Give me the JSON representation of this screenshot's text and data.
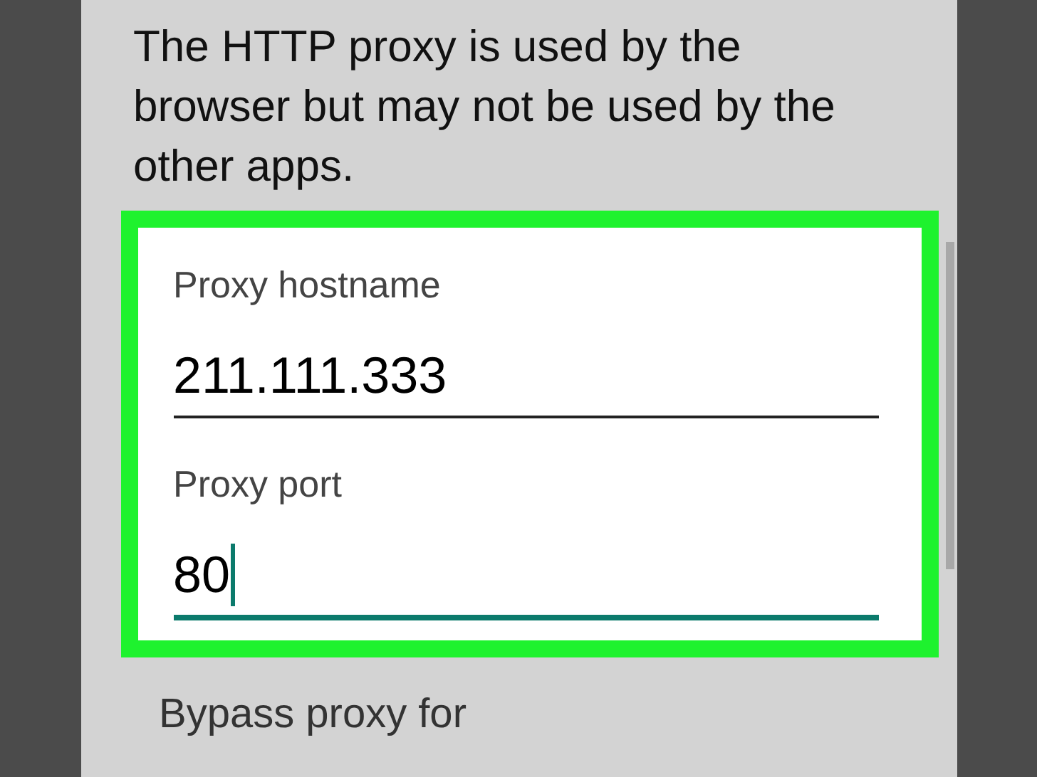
{
  "dialog": {
    "message": "The HTTP proxy is used by the browser but may not be used by the other apps.",
    "fields": [
      {
        "label": "Proxy hostname",
        "value": "211.111.333",
        "focused": false
      },
      {
        "label": "Proxy port",
        "value": "80",
        "focused": true
      }
    ],
    "highlighted": true,
    "next_label": "Bypass proxy for"
  }
}
